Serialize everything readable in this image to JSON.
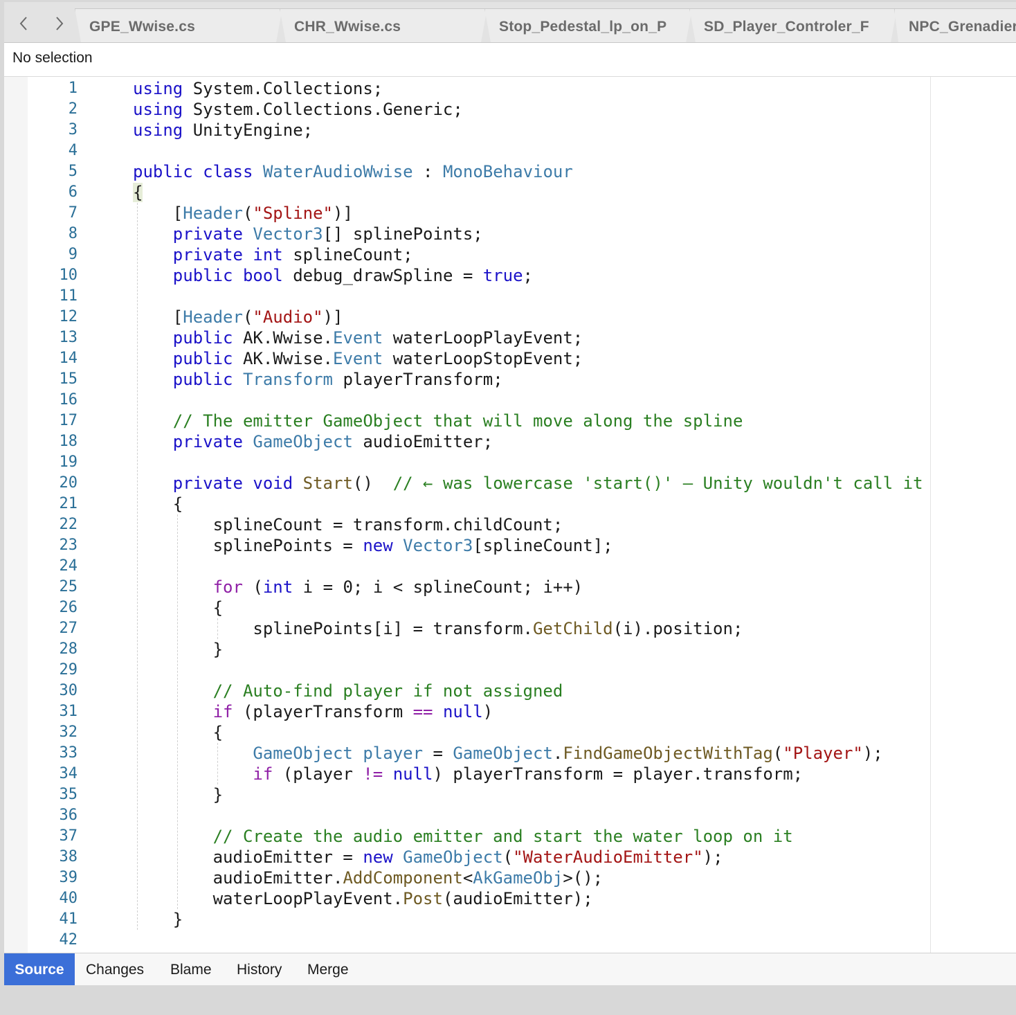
{
  "tabs": [
    {
      "label": "GPE_Wwise.cs"
    },
    {
      "label": "CHR_Wwise.cs"
    },
    {
      "label": "Stop_Pedestal_lp_on_P"
    },
    {
      "label": "SD_Player_Controler_F"
    },
    {
      "label": "NPC_Grenadier"
    }
  ],
  "selection": {
    "label": "No selection"
  },
  "bottom_tabs": [
    {
      "label": "Source"
    },
    {
      "label": "Changes"
    },
    {
      "label": "Blame"
    },
    {
      "label": "History"
    },
    {
      "label": "Merge"
    }
  ],
  "editor": {
    "line_numbers": [
      "1",
      "2",
      "3",
      "4",
      "5",
      "6",
      "7",
      "8",
      "9",
      "10",
      "11",
      "12",
      "13",
      "14",
      "15",
      "16",
      "17",
      "18",
      "19",
      "20",
      "21",
      "22",
      "23",
      "24",
      "25",
      "26",
      "27",
      "28",
      "29",
      "30",
      "31",
      "32",
      "33",
      "34",
      "35",
      "36",
      "37",
      "38",
      "39",
      "40",
      "41",
      "42"
    ],
    "lines": [
      [
        {
          "t": "using",
          "c": "kw"
        },
        {
          "t": " System.Collections;"
        }
      ],
      [
        {
          "t": "using",
          "c": "kw"
        },
        {
          "t": " System.Collections.Generic;"
        }
      ],
      [
        {
          "t": "using",
          "c": "kw"
        },
        {
          "t": " UnityEngine;"
        }
      ],
      [],
      [
        {
          "t": "public",
          "c": "kw"
        },
        {
          "t": " "
        },
        {
          "t": "class",
          "c": "kw"
        },
        {
          "t": " "
        },
        {
          "t": "WaterAudioWwise",
          "c": "ty"
        },
        {
          "t": " : "
        },
        {
          "t": "MonoBehaviour",
          "c": "ty"
        }
      ],
      [
        {
          "t": "{",
          "c": "br-hi"
        }
      ],
      [
        {
          "t": "    ["
        },
        {
          "t": "Header",
          "c": "ty"
        },
        {
          "t": "("
        },
        {
          "t": "\"Spline\"",
          "c": "str"
        },
        {
          "t": ")]"
        }
      ],
      [
        {
          "t": "    "
        },
        {
          "t": "private",
          "c": "kw"
        },
        {
          "t": " "
        },
        {
          "t": "Vector3",
          "c": "ty"
        },
        {
          "t": "[] splinePoints;"
        }
      ],
      [
        {
          "t": "    "
        },
        {
          "t": "private",
          "c": "kw"
        },
        {
          "t": " "
        },
        {
          "t": "int",
          "c": "kw"
        },
        {
          "t": " splineCount;"
        }
      ],
      [
        {
          "t": "    "
        },
        {
          "t": "public",
          "c": "kw"
        },
        {
          "t": " "
        },
        {
          "t": "bool",
          "c": "kw"
        },
        {
          "t": " debug_drawSpline = "
        },
        {
          "t": "true",
          "c": "kw"
        },
        {
          "t": ";"
        }
      ],
      [],
      [
        {
          "t": "    ["
        },
        {
          "t": "Header",
          "c": "ty"
        },
        {
          "t": "("
        },
        {
          "t": "\"Audio\"",
          "c": "str"
        },
        {
          "t": ")]"
        }
      ],
      [
        {
          "t": "    "
        },
        {
          "t": "public",
          "c": "kw"
        },
        {
          "t": " AK.Wwise."
        },
        {
          "t": "Event",
          "c": "ty"
        },
        {
          "t": " waterLoopPlayEvent;"
        }
      ],
      [
        {
          "t": "    "
        },
        {
          "t": "public",
          "c": "kw"
        },
        {
          "t": " AK.Wwise."
        },
        {
          "t": "Event",
          "c": "ty"
        },
        {
          "t": " waterLoopStopEvent;"
        }
      ],
      [
        {
          "t": "    "
        },
        {
          "t": "public",
          "c": "kw"
        },
        {
          "t": " "
        },
        {
          "t": "Transform",
          "c": "ty"
        },
        {
          "t": " playerTransform;"
        }
      ],
      [],
      [
        {
          "t": "    "
        },
        {
          "t": "// The emitter GameObject that will move along the spline",
          "c": "cm"
        }
      ],
      [
        {
          "t": "    "
        },
        {
          "t": "private",
          "c": "kw"
        },
        {
          "t": " "
        },
        {
          "t": "GameObject",
          "c": "ty"
        },
        {
          "t": " audioEmitter;"
        }
      ],
      [],
      [
        {
          "t": "    "
        },
        {
          "t": "private",
          "c": "kw"
        },
        {
          "t": " "
        },
        {
          "t": "void",
          "c": "kw"
        },
        {
          "t": " "
        },
        {
          "t": "Start",
          "c": "fn"
        },
        {
          "t": "()  "
        },
        {
          "t": "// ← was lowercase 'start()' — Unity wouldn't call it",
          "c": "cm"
        }
      ],
      [
        {
          "t": "    {"
        }
      ],
      [
        {
          "t": "        splineCount = transform.childCount;"
        }
      ],
      [
        {
          "t": "        splinePoints = "
        },
        {
          "t": "new",
          "c": "kw"
        },
        {
          "t": " "
        },
        {
          "t": "Vector3",
          "c": "ty"
        },
        {
          "t": "[splineCount];"
        }
      ],
      [],
      [
        {
          "t": "        "
        },
        {
          "t": "for",
          "c": "ctl"
        },
        {
          "t": " ("
        },
        {
          "t": "int",
          "c": "kw"
        },
        {
          "t": " i = 0; i < splineCount; i++)"
        }
      ],
      [
        {
          "t": "        {"
        }
      ],
      [
        {
          "t": "            splinePoints[i] = transform."
        },
        {
          "t": "GetChild",
          "c": "fn"
        },
        {
          "t": "(i).position;"
        }
      ],
      [
        {
          "t": "        }"
        }
      ],
      [],
      [
        {
          "t": "        "
        },
        {
          "t": "// Auto-find player if not assigned",
          "c": "cm"
        }
      ],
      [
        {
          "t": "        "
        },
        {
          "t": "if",
          "c": "ctl"
        },
        {
          "t": " (playerTransform "
        },
        {
          "t": "==",
          "c": "ctl"
        },
        {
          "t": " "
        },
        {
          "t": "null",
          "c": "kw"
        },
        {
          "t": ")"
        }
      ],
      [
        {
          "t": "        {"
        }
      ],
      [
        {
          "t": "            "
        },
        {
          "t": "GameObject",
          "c": "ty"
        },
        {
          "t": " "
        },
        {
          "t": "player",
          "c": "ty"
        },
        {
          "t": " = "
        },
        {
          "t": "GameObject",
          "c": "ty"
        },
        {
          "t": "."
        },
        {
          "t": "FindGameObjectWithTag",
          "c": "fn"
        },
        {
          "t": "("
        },
        {
          "t": "\"Player\"",
          "c": "str"
        },
        {
          "t": ");"
        }
      ],
      [
        {
          "t": "            "
        },
        {
          "t": "if",
          "c": "ctl"
        },
        {
          "t": " (player "
        },
        {
          "t": "!=",
          "c": "ctl"
        },
        {
          "t": " "
        },
        {
          "t": "null",
          "c": "kw"
        },
        {
          "t": ") playerTransform = player.transform;"
        }
      ],
      [
        {
          "t": "        }"
        }
      ],
      [],
      [
        {
          "t": "        "
        },
        {
          "t": "// Create the audio emitter and start the water loop on it",
          "c": "cm"
        }
      ],
      [
        {
          "t": "        audioEmitter = "
        },
        {
          "t": "new",
          "c": "kw"
        },
        {
          "t": " "
        },
        {
          "t": "GameObject",
          "c": "ty"
        },
        {
          "t": "("
        },
        {
          "t": "\"WaterAudioEmitter\"",
          "c": "str"
        },
        {
          "t": ");"
        }
      ],
      [
        {
          "t": "        audioEmitter."
        },
        {
          "t": "AddComponent",
          "c": "fn"
        },
        {
          "t": "<"
        },
        {
          "t": "AkGameObj",
          "c": "ty"
        },
        {
          "t": ">();"
        }
      ],
      [
        {
          "t": "        waterLoopPlayEvent."
        },
        {
          "t": "Post",
          "c": "fn"
        },
        {
          "t": "(audioEmitter);"
        }
      ],
      [
        {
          "t": "    }"
        }
      ],
      []
    ]
  }
}
